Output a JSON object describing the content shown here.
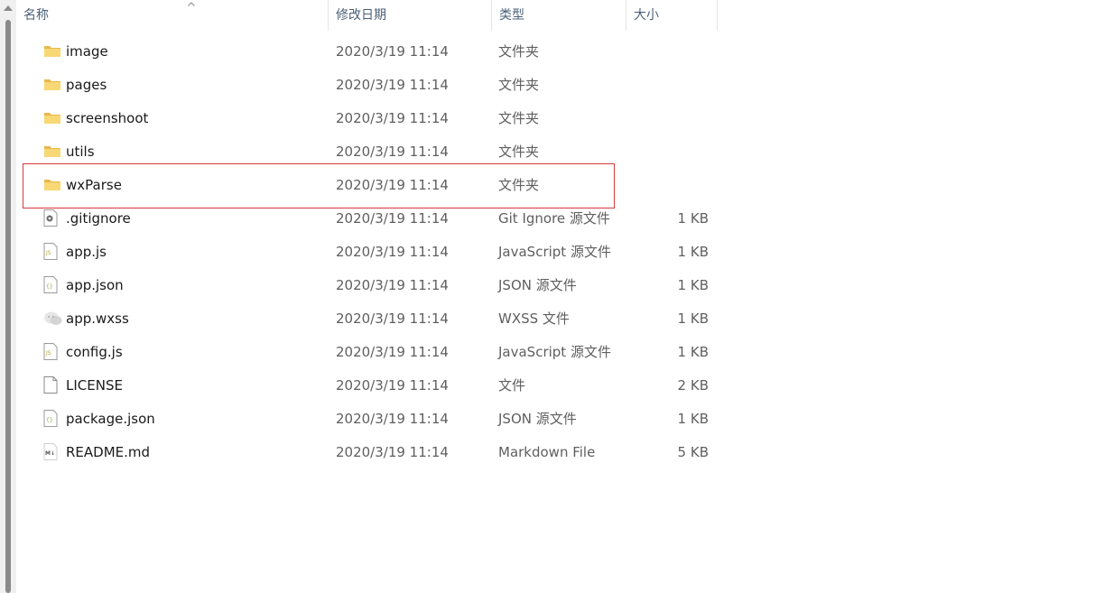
{
  "header": {
    "name": "名称",
    "date": "修改日期",
    "type": "类型",
    "size": "大小"
  },
  "files": [
    {
      "name": "image",
      "date": "2020/3/19 11:14",
      "type": "文件夹",
      "size": "",
      "icon": "folder-icon"
    },
    {
      "name": "pages",
      "date": "2020/3/19 11:14",
      "type": "文件夹",
      "size": "",
      "icon": "folder-icon"
    },
    {
      "name": "screenshoot",
      "date": "2020/3/19 11:14",
      "type": "文件夹",
      "size": "",
      "icon": "folder-icon"
    },
    {
      "name": "utils",
      "date": "2020/3/19 11:14",
      "type": "文件夹",
      "size": "",
      "icon": "folder-icon"
    },
    {
      "name": "wxParse",
      "date": "2020/3/19 11:14",
      "type": "文件夹",
      "size": "",
      "icon": "folder-icon"
    },
    {
      "name": ".gitignore",
      "date": "2020/3/19 11:14",
      "type": "Git Ignore 源文件",
      "size": "1 KB",
      "icon": "gear-file-icon"
    },
    {
      "name": "app.js",
      "date": "2020/3/19 11:14",
      "type": "JavaScript 源文件",
      "size": "1 KB",
      "icon": "js-file-icon"
    },
    {
      "name": "app.json",
      "date": "2020/3/19 11:14",
      "type": "JSON 源文件",
      "size": "1 KB",
      "icon": "json-file-icon"
    },
    {
      "name": "app.wxss",
      "date": "2020/3/19 11:14",
      "type": "WXSS 文件",
      "size": "1 KB",
      "icon": "wechat-file-icon"
    },
    {
      "name": "config.js",
      "date": "2020/3/19 11:14",
      "type": "JavaScript 源文件",
      "size": "1 KB",
      "icon": "js-file-icon"
    },
    {
      "name": "LICENSE",
      "date": "2020/3/19 11:14",
      "type": "文件",
      "size": "2 KB",
      "icon": "blank-file-icon"
    },
    {
      "name": "package.json",
      "date": "2020/3/19 11:14",
      "type": "JSON 源文件",
      "size": "1 KB",
      "icon": "json-file-icon"
    },
    {
      "name": "README.md",
      "date": "2020/3/19 11:14",
      "type": "Markdown File",
      "size": "5 KB",
      "icon": "markdown-file-icon"
    }
  ],
  "colors": {
    "folder": "#f8d775",
    "folder_dark": "#e8b84a",
    "highlight": "#d93a3a",
    "header_text": "#4c607a",
    "js_text": "#b9a53a",
    "json_text": "#8aa838"
  }
}
